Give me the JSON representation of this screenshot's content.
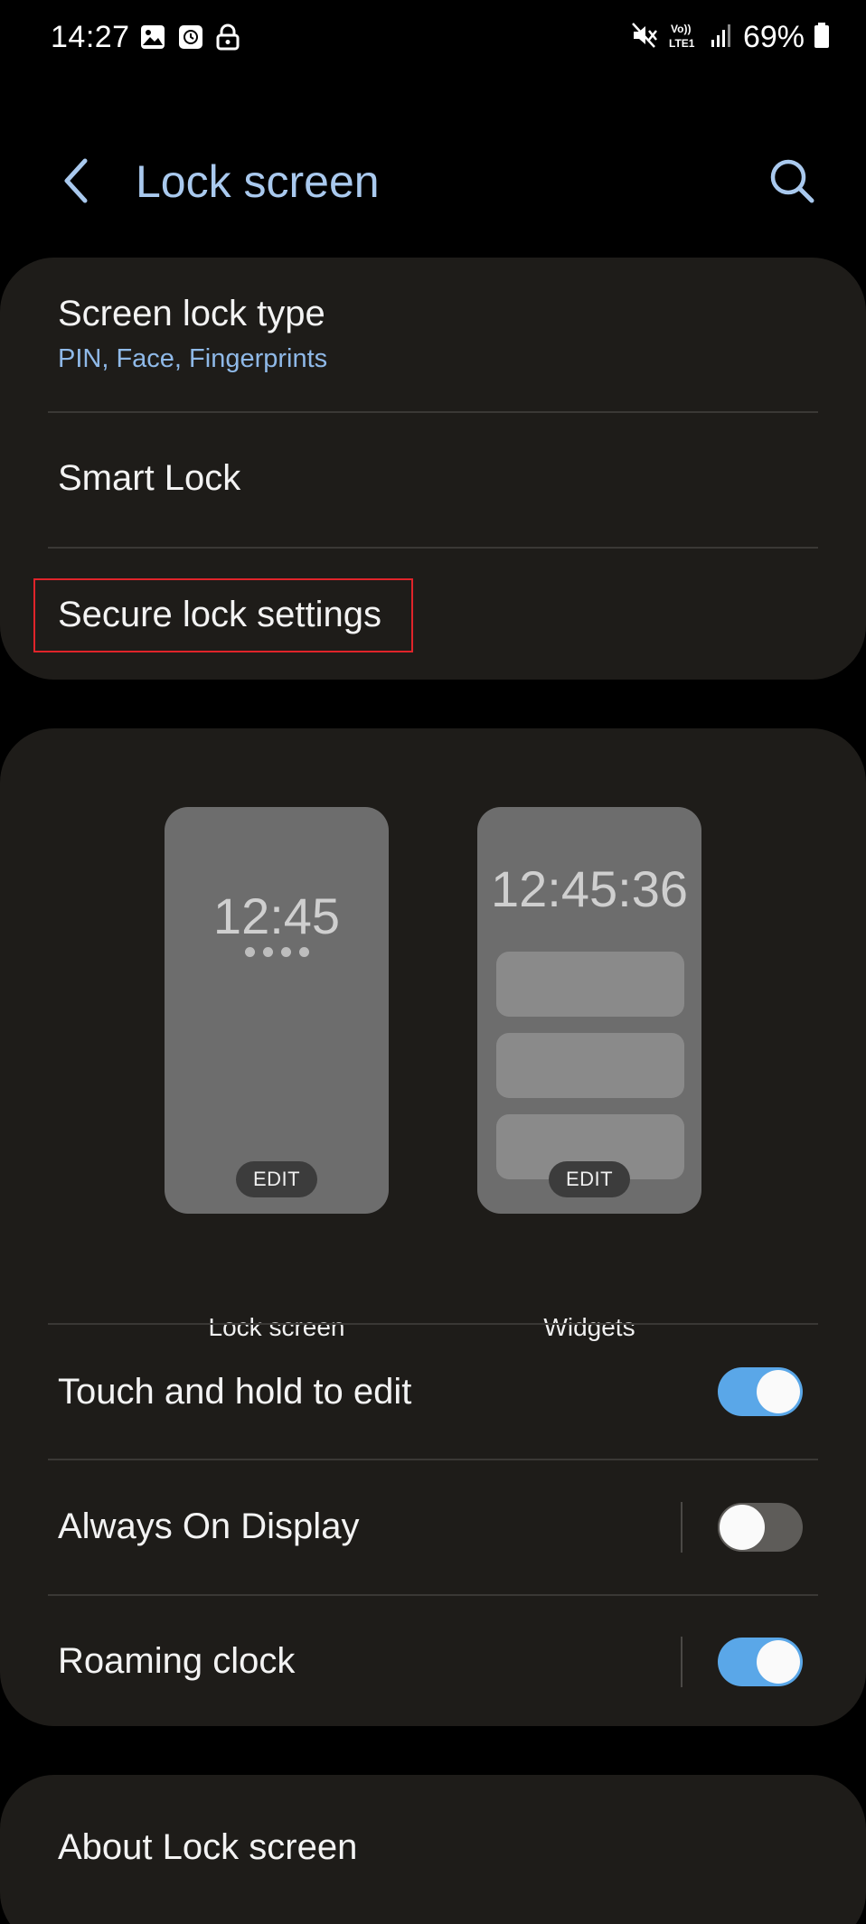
{
  "status_bar": {
    "time": "14:27",
    "battery": "69%",
    "left_icons": [
      "image-icon",
      "alarm-clock-icon",
      "lock-icon"
    ],
    "right_icons": [
      "mute-icon",
      "volte-lte-icon",
      "signal-icon",
      "battery-icon"
    ],
    "volte_label": "VoLTE1"
  },
  "header": {
    "title": "Lock screen",
    "back_icon": "chevron-left-icon",
    "search_icon": "search-icon"
  },
  "section1": {
    "screen_lock_type": {
      "title": "Screen lock type",
      "subtitle": "PIN, Face, Fingerprints"
    },
    "smart_lock": {
      "title": "Smart Lock"
    },
    "secure_lock": {
      "title": "Secure lock settings"
    }
  },
  "previews": {
    "lock_screen": {
      "clock": "12:45",
      "edit": "EDIT",
      "label": "Lock screen"
    },
    "widgets": {
      "clock": "12:45:36",
      "edit": "EDIT",
      "label": "Widgets"
    }
  },
  "settings": {
    "touch_hold": {
      "title": "Touch and hold to edit",
      "on": true
    },
    "always_on": {
      "title": "Always On Display",
      "on": false
    },
    "roaming_clock": {
      "title": "Roaming clock",
      "on": true
    }
  },
  "about": {
    "title": "About Lock screen"
  },
  "colors": {
    "title_accent": "#a9c9ee",
    "subtitle_accent": "#8fb9e8",
    "toggle_on": "#5aa7e8",
    "highlight": "#e0242a",
    "card_bg": "#1e1c19"
  }
}
